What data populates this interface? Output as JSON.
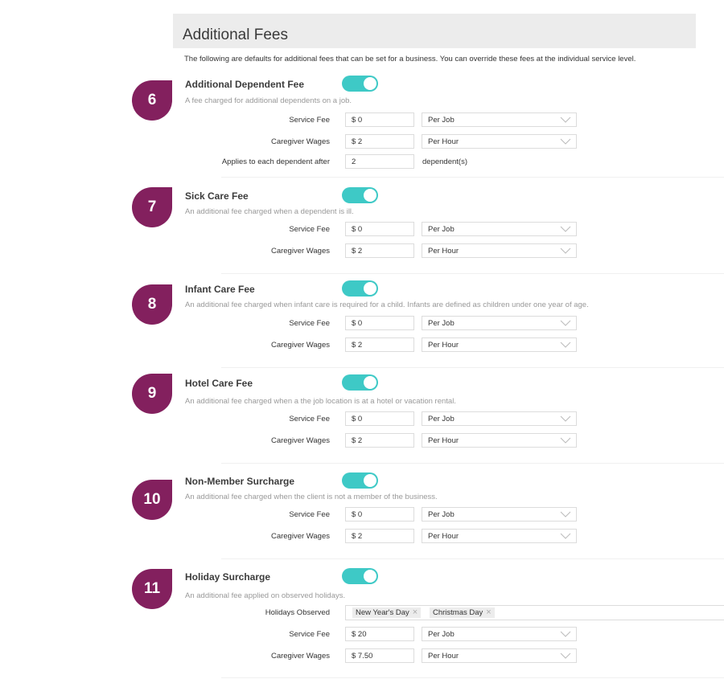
{
  "header": {
    "title": "Additional Fees"
  },
  "intro": "The following are defaults for additional fees that can be set for a business. You can override these fees at the individual service level.",
  "colors": {
    "badge": "#83205e",
    "toggle": "#3ec9c6"
  },
  "sections": [
    {
      "badge": "6",
      "title": "Additional Dependent Fee",
      "enabled": true,
      "description": "A fee charged for additional dependents on a job.",
      "service_fee_label": "Service Fee",
      "service_fee": "$ 0",
      "service_fee_unit": "Per Job",
      "wages_label": "Caregiver Wages",
      "wages": "$ 2",
      "wages_unit": "Per Hour",
      "after_label": "Applies to each dependent after",
      "after_value": "2",
      "after_suffix": "dependent(s)"
    },
    {
      "badge": "7",
      "title": "Sick Care Fee",
      "enabled": true,
      "description": "An additional fee charged when a dependent is ill.",
      "service_fee_label": "Service Fee",
      "service_fee": "$ 0",
      "service_fee_unit": "Per Job",
      "wages_label": "Caregiver Wages",
      "wages": "$ 2",
      "wages_unit": "Per Hour"
    },
    {
      "badge": "8",
      "title": "Infant Care Fee",
      "enabled": true,
      "description": "An additional fee charged when infant care is required for a child. Infants are defined as children under one year of age.",
      "service_fee_label": "Service Fee",
      "service_fee": "$ 0",
      "service_fee_unit": "Per Job",
      "wages_label": "Caregiver Wages",
      "wages": "$ 2",
      "wages_unit": "Per Hour"
    },
    {
      "badge": "9",
      "title": "Hotel Care Fee",
      "enabled": true,
      "description": "An additional fee charged when a the job location is at a hotel or vacation rental.",
      "service_fee_label": "Service Fee",
      "service_fee": "$ 0",
      "service_fee_unit": "Per Job",
      "wages_label": "Caregiver Wages",
      "wages": "$ 2",
      "wages_unit": "Per Hour"
    },
    {
      "badge": "10",
      "title": "Non-Member Surcharge",
      "enabled": true,
      "description": "An additional fee charged when the client is not a member of the business.",
      "service_fee_label": "Service Fee",
      "service_fee": "$ 0",
      "service_fee_unit": "Per Job",
      "wages_label": "Caregiver Wages",
      "wages": "$ 2",
      "wages_unit": "Per Hour"
    },
    {
      "badge": "11",
      "title": "Holiday Surcharge",
      "enabled": true,
      "description": "An additional fee applied on observed holidays.",
      "holidays_label": "Holidays Observed",
      "holidays": [
        "New Year's Day",
        "Christmas Day"
      ],
      "service_fee_label": "Service Fee",
      "service_fee": "$ 20",
      "service_fee_unit": "Per Job",
      "wages_label": "Caregiver Wages",
      "wages": "$ 7.50",
      "wages_unit": "Per Hour"
    }
  ]
}
